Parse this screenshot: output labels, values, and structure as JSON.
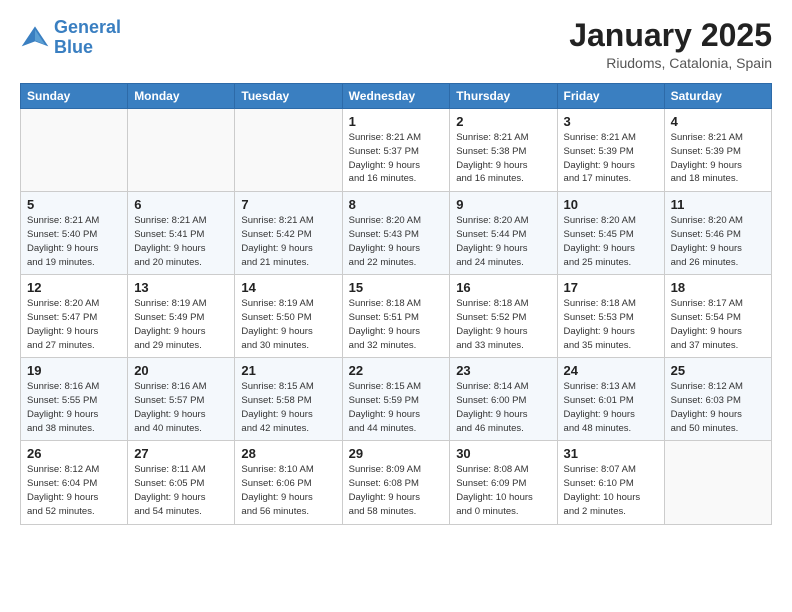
{
  "header": {
    "logo_line1": "General",
    "logo_line2": "Blue",
    "month": "January 2025",
    "location": "Riudoms, Catalonia, Spain"
  },
  "days_of_week": [
    "Sunday",
    "Monday",
    "Tuesday",
    "Wednesday",
    "Thursday",
    "Friday",
    "Saturday"
  ],
  "weeks": [
    [
      {
        "num": "",
        "info": ""
      },
      {
        "num": "",
        "info": ""
      },
      {
        "num": "",
        "info": ""
      },
      {
        "num": "1",
        "info": "Sunrise: 8:21 AM\nSunset: 5:37 PM\nDaylight: 9 hours\nand 16 minutes."
      },
      {
        "num": "2",
        "info": "Sunrise: 8:21 AM\nSunset: 5:38 PM\nDaylight: 9 hours\nand 16 minutes."
      },
      {
        "num": "3",
        "info": "Sunrise: 8:21 AM\nSunset: 5:39 PM\nDaylight: 9 hours\nand 17 minutes."
      },
      {
        "num": "4",
        "info": "Sunrise: 8:21 AM\nSunset: 5:39 PM\nDaylight: 9 hours\nand 18 minutes."
      }
    ],
    [
      {
        "num": "5",
        "info": "Sunrise: 8:21 AM\nSunset: 5:40 PM\nDaylight: 9 hours\nand 19 minutes."
      },
      {
        "num": "6",
        "info": "Sunrise: 8:21 AM\nSunset: 5:41 PM\nDaylight: 9 hours\nand 20 minutes."
      },
      {
        "num": "7",
        "info": "Sunrise: 8:21 AM\nSunset: 5:42 PM\nDaylight: 9 hours\nand 21 minutes."
      },
      {
        "num": "8",
        "info": "Sunrise: 8:20 AM\nSunset: 5:43 PM\nDaylight: 9 hours\nand 22 minutes."
      },
      {
        "num": "9",
        "info": "Sunrise: 8:20 AM\nSunset: 5:44 PM\nDaylight: 9 hours\nand 24 minutes."
      },
      {
        "num": "10",
        "info": "Sunrise: 8:20 AM\nSunset: 5:45 PM\nDaylight: 9 hours\nand 25 minutes."
      },
      {
        "num": "11",
        "info": "Sunrise: 8:20 AM\nSunset: 5:46 PM\nDaylight: 9 hours\nand 26 minutes."
      }
    ],
    [
      {
        "num": "12",
        "info": "Sunrise: 8:20 AM\nSunset: 5:47 PM\nDaylight: 9 hours\nand 27 minutes."
      },
      {
        "num": "13",
        "info": "Sunrise: 8:19 AM\nSunset: 5:49 PM\nDaylight: 9 hours\nand 29 minutes."
      },
      {
        "num": "14",
        "info": "Sunrise: 8:19 AM\nSunset: 5:50 PM\nDaylight: 9 hours\nand 30 minutes."
      },
      {
        "num": "15",
        "info": "Sunrise: 8:18 AM\nSunset: 5:51 PM\nDaylight: 9 hours\nand 32 minutes."
      },
      {
        "num": "16",
        "info": "Sunrise: 8:18 AM\nSunset: 5:52 PM\nDaylight: 9 hours\nand 33 minutes."
      },
      {
        "num": "17",
        "info": "Sunrise: 8:18 AM\nSunset: 5:53 PM\nDaylight: 9 hours\nand 35 minutes."
      },
      {
        "num": "18",
        "info": "Sunrise: 8:17 AM\nSunset: 5:54 PM\nDaylight: 9 hours\nand 37 minutes."
      }
    ],
    [
      {
        "num": "19",
        "info": "Sunrise: 8:16 AM\nSunset: 5:55 PM\nDaylight: 9 hours\nand 38 minutes."
      },
      {
        "num": "20",
        "info": "Sunrise: 8:16 AM\nSunset: 5:57 PM\nDaylight: 9 hours\nand 40 minutes."
      },
      {
        "num": "21",
        "info": "Sunrise: 8:15 AM\nSunset: 5:58 PM\nDaylight: 9 hours\nand 42 minutes."
      },
      {
        "num": "22",
        "info": "Sunrise: 8:15 AM\nSunset: 5:59 PM\nDaylight: 9 hours\nand 44 minutes."
      },
      {
        "num": "23",
        "info": "Sunrise: 8:14 AM\nSunset: 6:00 PM\nDaylight: 9 hours\nand 46 minutes."
      },
      {
        "num": "24",
        "info": "Sunrise: 8:13 AM\nSunset: 6:01 PM\nDaylight: 9 hours\nand 48 minutes."
      },
      {
        "num": "25",
        "info": "Sunrise: 8:12 AM\nSunset: 6:03 PM\nDaylight: 9 hours\nand 50 minutes."
      }
    ],
    [
      {
        "num": "26",
        "info": "Sunrise: 8:12 AM\nSunset: 6:04 PM\nDaylight: 9 hours\nand 52 minutes."
      },
      {
        "num": "27",
        "info": "Sunrise: 8:11 AM\nSunset: 6:05 PM\nDaylight: 9 hours\nand 54 minutes."
      },
      {
        "num": "28",
        "info": "Sunrise: 8:10 AM\nSunset: 6:06 PM\nDaylight: 9 hours\nand 56 minutes."
      },
      {
        "num": "29",
        "info": "Sunrise: 8:09 AM\nSunset: 6:08 PM\nDaylight: 9 hours\nand 58 minutes."
      },
      {
        "num": "30",
        "info": "Sunrise: 8:08 AM\nSunset: 6:09 PM\nDaylight: 10 hours\nand 0 minutes."
      },
      {
        "num": "31",
        "info": "Sunrise: 8:07 AM\nSunset: 6:10 PM\nDaylight: 10 hours\nand 2 minutes."
      },
      {
        "num": "",
        "info": ""
      }
    ]
  ]
}
